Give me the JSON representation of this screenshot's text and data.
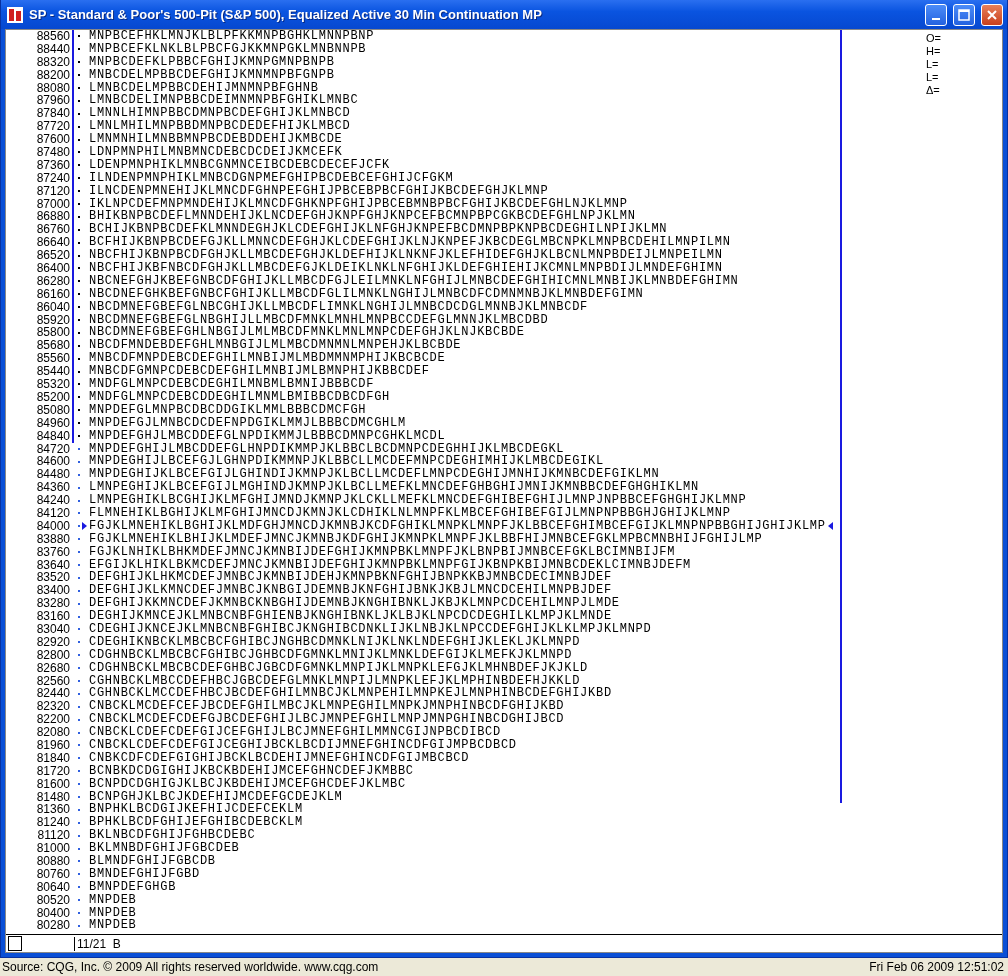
{
  "window": {
    "title": "SP - Standard & Poor's 500-Pit (S&P 500), Equalized Active 30 Min Continuation MP"
  },
  "profile": {
    "rows": [
      {
        "price": "88560",
        "letters": "MNPBCEFHKLMNJKLBLPFKKMNPBGHKLMNNPBNP",
        "value_area": true,
        "in_range": true,
        "marked": false
      },
      {
        "price": "88440",
        "letters": "MNPBCEFKLNKLBLPBCFGJKKMNPGKLMNBNNPB",
        "value_area": true,
        "in_range": true,
        "marked": false
      },
      {
        "price": "88320",
        "letters": "MNPBCDEFKLPBBCFGHIJKMNPGMNPBNPB",
        "value_area": true,
        "in_range": true,
        "marked": false
      },
      {
        "price": "88200",
        "letters": "MNBCDELMPBBCDEFGHIJKMNMNPBFGNPB",
        "value_area": true,
        "in_range": true,
        "marked": false
      },
      {
        "price": "88080",
        "letters": "LMNBCDELMPBBCDEHIJMNMNPBFGHNB",
        "value_area": true,
        "in_range": true,
        "marked": false
      },
      {
        "price": "87960",
        "letters": "LMNBCDELIMNPBBCDEIMNMNPBFGHIKLMNBC",
        "value_area": true,
        "in_range": true,
        "marked": false
      },
      {
        "price": "87840",
        "letters": "LMNNLHIMNPBBCDMNPBCDEFGHIJKLMNBCD",
        "value_area": true,
        "in_range": true,
        "marked": false
      },
      {
        "price": "87720",
        "letters": "LMNLMHILMNPBBDMNPBCDEDEFHIJKLMBCD",
        "value_area": true,
        "in_range": true,
        "marked": false
      },
      {
        "price": "87600",
        "letters": "LMNMNHILMNBBMNPBCDEBDDEHIJKMBCDE",
        "value_area": true,
        "in_range": true,
        "marked": false
      },
      {
        "price": "87480",
        "letters": "LDNPMNPHILMNBMNCDEBCDCDEIJKMCEFK",
        "value_area": true,
        "in_range": true,
        "marked": false
      },
      {
        "price": "87360",
        "letters": "LDENPMNPHIKLMNBCGNMNCEIBCDEBCDECEFJCFK",
        "value_area": true,
        "in_range": true,
        "marked": false
      },
      {
        "price": "87240",
        "letters": "ILNDENPMNPHIKLMNBCDGNPMEFGHIPBCDEBCEFGHIJCFGKM",
        "value_area": true,
        "in_range": true,
        "marked": false
      },
      {
        "price": "87120",
        "letters": "ILNCDENPMNEHIJKLMNCDFGHNPEFGHIJPBCEBPBCFGHIJKBCDEFGHJKLMNP",
        "value_area": true,
        "in_range": true,
        "marked": false
      },
      {
        "price": "87000",
        "letters": "IKLNPCDEFMNPMNDEHIJKLMNCDFGHKNPFGHIJPBCEBMNBPBCFGHIJKBCDEFGHLNJKLMNP",
        "value_area": true,
        "in_range": true,
        "marked": false
      },
      {
        "price": "86880",
        "letters": "BHIKBNPBCDEFLMNNDEHIJKLNCDEFGHJKNPFGHJKNPCEFBCMNPBPCGKBCDEFGHLNPJKLMN",
        "value_area": true,
        "in_range": true,
        "marked": false
      },
      {
        "price": "86760",
        "letters": "BCHIJKBNPBCDEFKLMNNDEGHJKLCDEFGHIJKLNFGHJKNPEFBCDMNPBPKNPBCDEGHILNPIJKLMN",
        "value_area": true,
        "in_range": true,
        "marked": false
      },
      {
        "price": "86640",
        "letters": "BCFHIJKBNPBCDEFGJKLLMNNCDEFGHJKLCDEFGHIJKLNJKNPEFJKBCDEGLMBCNPKLMNPBCDEHILMNPILMN",
        "value_area": true,
        "in_range": true,
        "marked": false
      },
      {
        "price": "86520",
        "letters": "NBCFHIJKBNPBCDFGHJKLLMBCDEFGHJKLDEFHIJKLNKNFJKLEFHIDEFGHJKLBCNLMNPBDEIJLMNPEILMN",
        "value_area": true,
        "in_range": true,
        "marked": false
      },
      {
        "price": "86400",
        "letters": "NBCFHIJKBFNBCDFGHJKLLMBCDEFGJKLDEIKLNKLNFGHIJKLDEFGHIEHIJKCMNLMNPBDIJLMNDEFGHIMN",
        "value_area": true,
        "in_range": true,
        "marked": false
      },
      {
        "price": "86280",
        "letters": "NBCNEFGHJKBEFGNBCDFGHIJKLLMBCDFGJLEILMNKLNFGHIJLMNBCDEFGHIHICMNLMNBIJKLMNBDEFGHIMN",
        "value_area": true,
        "in_range": true,
        "marked": false
      },
      {
        "price": "86160",
        "letters": "NBCDNEFGHKBEFGNBCFGHIJKLLMBCDFGLILMNKLNGHIJLMNBCDFCDMNMNBJKLMNBDEFGIMN",
        "value_area": true,
        "in_range": true,
        "marked": false
      },
      {
        "price": "86040",
        "letters": "NBCDMNEFGBEFGLNBCGHIJKLLMBCDFLIMNKLNGHIJLMNBCDCDGLMNNBJKLMNBCDF",
        "value_area": true,
        "in_range": true,
        "marked": false
      },
      {
        "price": "85920",
        "letters": "NBCDMNEFGBEFGLNBGHIJLLMBCDFMNKLMNHLMNPBCCDEFGLMNNJKLMBCDBD",
        "value_area": true,
        "in_range": true,
        "marked": false
      },
      {
        "price": "85800",
        "letters": "NBCDMNEFGBEFGHLNBGIJLMLMBCDFMNKLMNLMNPCDEFGHJKLNJKBCBDE",
        "value_area": true,
        "in_range": true,
        "marked": false
      },
      {
        "price": "85680",
        "letters": "NBCDFMNDEBDEFGHLMNBGIJLMLMBCDMNMNLMNPEHJKLBCBDE",
        "value_area": true,
        "in_range": true,
        "marked": false
      },
      {
        "price": "85560",
        "letters": "MNBCDFMNPDEBCDEFGHILMNBIJMLMBDMMNMPHIJKBCBCDE",
        "value_area": true,
        "in_range": true,
        "marked": false
      },
      {
        "price": "85440",
        "letters": "MNBCDFGMNPCDEBCDEFGHILMNBIJMLBMNPHIJKBBCDEF",
        "value_area": true,
        "in_range": true,
        "marked": false
      },
      {
        "price": "85320",
        "letters": "MNDFGLMNPCDEBCDEGHILMNBMLBMNIJBBBCDF",
        "value_area": true,
        "in_range": true,
        "marked": false
      },
      {
        "price": "85200",
        "letters": "MNDFGLMNPCDEBCDDEGHILMNMLBMIBBCDBCDFGH",
        "value_area": true,
        "in_range": true,
        "marked": false
      },
      {
        "price": "85080",
        "letters": "MNPDEFGLMNPBCDBCDDGIKLMMLBBBCDMCFGH",
        "value_area": true,
        "in_range": true,
        "marked": false
      },
      {
        "price": "84960",
        "letters": "MNPDEFGJLMNBCDCDEFNPDGIKLMMJLBBBCDMCGHLM",
        "value_area": true,
        "in_range": true,
        "marked": false
      },
      {
        "price": "84840",
        "letters": "MNPDEFGHJLMBCDDEFGLNPDIKMMJLBBBCDMNPCGHKLMCDL",
        "value_area": true,
        "in_range": true,
        "marked": false
      },
      {
        "price": "84720",
        "letters": "MNPDEFGHIJLMBCDDEFGLHNPDIKMMPJKLBBCLBCDMNPCDEGHHIJKLMBCDEGKL",
        "value_area": false,
        "in_range": true,
        "marked": false
      },
      {
        "price": "84600",
        "letters": "MNPDEGHIJLBCEFGJLGHNPDIKMMNPJKLBBCLLMCDEFMNPCDEGHIMHIJKLMBCDEGIKL",
        "value_area": false,
        "in_range": true,
        "marked": false
      },
      {
        "price": "84480",
        "letters": "MNPDEGHIJKLBCEFGIJLGHINDIJKMNPJKLBCLLMCDEFLMNPCDEGHIJMNHIJKMNBCDEFGIKLMN",
        "value_area": false,
        "in_range": true,
        "marked": false
      },
      {
        "price": "84360",
        "letters": "LMNPEGHIJKLBCEFGIJLMGHINDJKMNPJKLBCLLMEFKLMNCDEFGHBGHIJMNIJKMNBBCDEFGHGHIKLMN",
        "value_area": false,
        "in_range": true,
        "marked": false
      },
      {
        "price": "84240",
        "letters": "LMNPEGHIKLBCGHIJKLMFGHIJMNDJKMNPJKLCKLLMEFKLMNCDEFGHIBEFGHIJLMNPJNPBBCEFGHGHIJKLMNP",
        "value_area": false,
        "in_range": true,
        "marked": false
      },
      {
        "price": "84120",
        "letters": "FLMNEHIKLBGHIJKLMFGHIJMNCDJKMNJKLCDHIKLNLMNPFKLMBCEFGHIBEFGIJLMNPNPBBGHJGHIJKLMNP",
        "value_area": false,
        "in_range": true,
        "marked": false
      },
      {
        "price": "84000",
        "letters": "FGJKLMNEHIKLBGHIJKLMDFGHJMNCDJKMNBJKCDFGHIKLMNPKLMNPFJKLBBCEFGHIMBCEFGIJKLMNPNPBBGHIJGHIJKLMP",
        "value_area": false,
        "in_range": true,
        "marked": true
      },
      {
        "price": "83880",
        "letters": "FGJKLMNEHIKLBHIJKLMDEFJMNCJKMNBJKDFGHIJKMNPKLMNPFJKLBBFHIJMNBCEFGKLMPBCMNBHIJFGHIJLMP",
        "value_area": false,
        "in_range": true,
        "marked": false
      },
      {
        "price": "83760",
        "letters": "FGJKLNHIKLBHKMDEFJMNCJKMNBIJDEFGHIJKMNPBKLMNPFJKLBNPBIJMNBCEFGKLBCIMNBIJFM",
        "value_area": false,
        "in_range": true,
        "marked": false
      },
      {
        "price": "83640",
        "letters": "EFGIJKLHIKLBKMCDEFJMNCJKMNBIJDEFGHIJKMNPBKLMNPFGIJKBNPKBIJMNBCDEKLCIMNBJDEFM",
        "value_area": false,
        "in_range": true,
        "marked": false
      },
      {
        "price": "83520",
        "letters": "DEFGHIJKLHKMCDEFJMNBCJKMNBIJDEHJKMNPBKNFGHIJBNPKKBJMNBCDECIMNBJDEF",
        "value_area": false,
        "in_range": true,
        "marked": false
      },
      {
        "price": "83400",
        "letters": "DEFGHIJKLKMNCDEFJMNBCJKNBGIJDEMNBJKNFGHIJBNKJKBJLMNCDCEHILMNPBJDEF",
        "value_area": false,
        "in_range": true,
        "marked": false
      },
      {
        "price": "83280",
        "letters": "DEFGHIJKKMNCDEFJKMNBCKNBGHIJDEMNBJKNGHIBNKLJKBJKLMNPCDCEHILMNPJLMDE",
        "value_area": false,
        "in_range": true,
        "marked": false
      },
      {
        "price": "83160",
        "letters": "DEGHIJKMNCEJKLMNBCNBFGHIENBJKNGHIBNKLJKLBJKLNPCDCDEGHILKLMPJKLMNDE",
        "value_area": false,
        "in_range": true,
        "marked": false
      },
      {
        "price": "83040",
        "letters": "CDEGHIJKNCEJKLMNBCNBFGHIBCJKNGHIBCDNKLIJKLNBJKLNPCCDEFGHIJKLKLMPJKLMNPD",
        "value_area": false,
        "in_range": true,
        "marked": false
      },
      {
        "price": "82920",
        "letters": "CDEGHIKNBCKLMBCBCFGHIBCJNGHBCDMNKLNIJKLNKLNDEFGHIJKLEKLJKLMNPD",
        "value_area": false,
        "in_range": true,
        "marked": false
      },
      {
        "price": "82800",
        "letters": "CDGHNBCKLMBCBCFGHIBCJGHBCDFGMNKLMNIJKLMNKLDEFGIJKLMEFKJKLMNPD",
        "value_area": false,
        "in_range": true,
        "marked": false
      },
      {
        "price": "82680",
        "letters": "CDGHNBCKLMBCBCDEFGHBCJGBCDFGMNKLMNPIJKLMNPKLEFGJKLMHNBDEFJKJKLD",
        "value_area": false,
        "in_range": true,
        "marked": false
      },
      {
        "price": "82560",
        "letters": "CGHNBCKLMBCCDEFHBCJGBCDEFGLMNKLMNPIJLMNPKLEFJKLMPHINBDEFHJKKLD",
        "value_area": false,
        "in_range": true,
        "marked": false
      },
      {
        "price": "82440",
        "letters": "CGHNBCKLMCCDEFHBCJBCDEFGHILMNBCJKLMNPEHILMNPKEJLMNPHINBCDEFGHIJKBD",
        "value_area": false,
        "in_range": true,
        "marked": false
      },
      {
        "price": "82320",
        "letters": "CNBCKLMCDEFCEFJBCDEFGHILMBCJKLMNPEGHILMNPKJMNPHINBCDFGHIJKBD",
        "value_area": false,
        "in_range": true,
        "marked": false
      },
      {
        "price": "82200",
        "letters": "CNBCKLMCDEFCDEFGJBCDEFGHIJLBCJMNPEFGHILMNPJMNPGHINBCDGHIJBCD",
        "value_area": false,
        "in_range": true,
        "marked": false
      },
      {
        "price": "82080",
        "letters": "CNBCKLCDEFCDEFGIJCEFGHIJLBCJMNEFGHILMMNCGIJNPBCDIBCD",
        "value_area": false,
        "in_range": true,
        "marked": false
      },
      {
        "price": "81960",
        "letters": "CNBCKLCDEFCDEFGIJCEGHIJBCKLBCDIJMNEFGHINCDFGIJMPBCDBCD",
        "value_area": false,
        "in_range": true,
        "marked": false
      },
      {
        "price": "81840",
        "letters": "CNBKCDFCDEFGIGHIJBCKLBCDEHIJMNEFGHINCDFGIJMBCBCD",
        "value_area": false,
        "in_range": true,
        "marked": false
      },
      {
        "price": "81720",
        "letters": "BCNBKDCDGIGHIJKBCKBDEHIJMCEFGHNCDEFJKMBBC",
        "value_area": false,
        "in_range": true,
        "marked": false
      },
      {
        "price": "81600",
        "letters": "BCNPDCDGHIGJKLBCJKBDEHIJMCEFGHCDEFJKLMBC",
        "value_area": false,
        "in_range": true,
        "marked": false
      },
      {
        "price": "81480",
        "letters": "BCNPGHJKLBCJKDEFHIJMCDEFGCDEJKLM",
        "value_area": false,
        "in_range": true,
        "marked": false
      },
      {
        "price": "81360",
        "letters": "BNPHKLBCDGIJKEFHIJCDEFCEKLM",
        "value_area": false,
        "in_range": false,
        "marked": false
      },
      {
        "price": "81240",
        "letters": "BPHKLBCDFGHIJEFGHIBCDEBCKLM",
        "value_area": false,
        "in_range": false,
        "marked": false
      },
      {
        "price": "81120",
        "letters": "BKLNBCDFGHIJFGHBCDEBC",
        "value_area": false,
        "in_range": false,
        "marked": false
      },
      {
        "price": "81000",
        "letters": "BKLMNBDFGHIJFGBCDEB",
        "value_area": false,
        "in_range": false,
        "marked": false
      },
      {
        "price": "80880",
        "letters": "BLMNDFGHIJFGBCDB",
        "value_area": false,
        "in_range": false,
        "marked": false
      },
      {
        "price": "80760",
        "letters": "BMNDEFGHIJFGBD",
        "value_area": false,
        "in_range": false,
        "marked": false
      },
      {
        "price": "80640",
        "letters": "BMNPDEFGHGB",
        "value_area": false,
        "in_range": false,
        "marked": false
      },
      {
        "price": "80520",
        "letters": "MNPDEB",
        "value_area": false,
        "in_range": false,
        "marked": false
      },
      {
        "price": "80400",
        "letters": "MNPDEB",
        "value_area": false,
        "in_range": false,
        "marked": false
      },
      {
        "price": "80280",
        "letters": "MNPDEB",
        "value_area": false,
        "in_range": false,
        "marked": false
      }
    ]
  },
  "legend": [
    "O=",
    "H=",
    "L=",
    "L=",
    "Δ="
  ],
  "footer": {
    "cursor": "11/21  B"
  },
  "status_bar": {
    "source": "Source: CQG, Inc. © 2009 All rights reserved worldwide. www.cqg.com",
    "datetime": "Fri Feb 06 2009 12:51:02"
  }
}
